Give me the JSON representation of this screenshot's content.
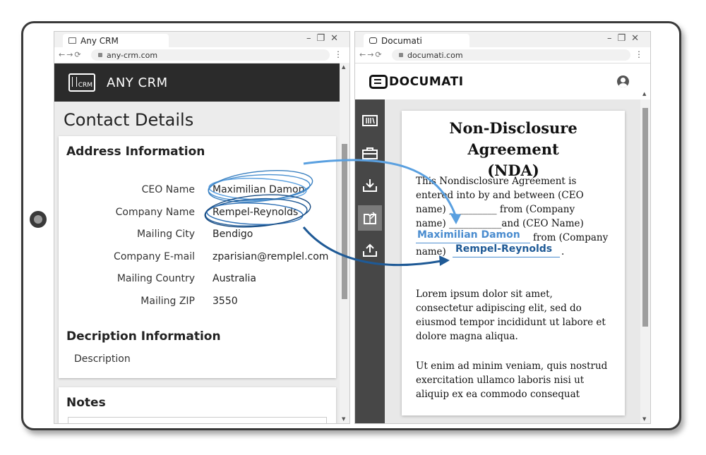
{
  "crm_window": {
    "tab_title": "Any CRM",
    "url": "any-crm.com",
    "app_title": "ANY CRM",
    "logo_text": "CRM",
    "page_title": "Contact Details",
    "address_section": {
      "heading": "Address Information",
      "fields": [
        {
          "label": "CEO Name",
          "value": "Maximilian Damon"
        },
        {
          "label": "Company Name",
          "value": "Rempel-Reynolds"
        },
        {
          "label": "Mailing City",
          "value": "Bendigo"
        },
        {
          "label": "Company E-mail",
          "value": "zparisian@remplel.com"
        },
        {
          "label": "Mailing Country",
          "value": "Australia"
        },
        {
          "label": "Mailing ZIP",
          "value": "3550"
        }
      ]
    },
    "description_section": {
      "heading": "Decription Information",
      "label": "Description"
    },
    "notes_section": {
      "heading": "Notes"
    }
  },
  "doc_window": {
    "tab_title": "Documati",
    "url": "documati.com",
    "brand": "DOCUMATI",
    "document": {
      "title_line1": "Non-Disclosure Agreement",
      "title_line2": "(NDA)",
      "intro_lines": [
        "This Nondisclosure Agreement is",
        "entered into by and between (CEO",
        "name) __________ from (Company",
        "name) ___________and (CEO Name)"
      ],
      "from_company": "from (Company",
      "name_word": "name)",
      "period": ".",
      "filled_ceo": "Maximilian Damon",
      "filled_company": "Rempel-Reynolds",
      "paragraph2": [
        "Lorem ipsum dolor sit amet,",
        "consectetur adipiscing elit, sed do",
        "eiusmod tempor incididunt ut labore et",
        "dolore magna aliqua."
      ],
      "paragraph3": [
        "Ut enim ad minim veniam, quis nostrud",
        "exercitation ullamco laboris nisi ut",
        "aliquip ex ea commodo consequat"
      ]
    },
    "sidebar_icons": [
      "library-icon",
      "briefcase-icon",
      "download-tray-icon",
      "fill-form-icon",
      "upload-tray-icon"
    ]
  },
  "colors": {
    "arrow_blue": "#2c6fb5",
    "crm_header": "#2b2b2b",
    "doc_sidebar": "#474747"
  }
}
